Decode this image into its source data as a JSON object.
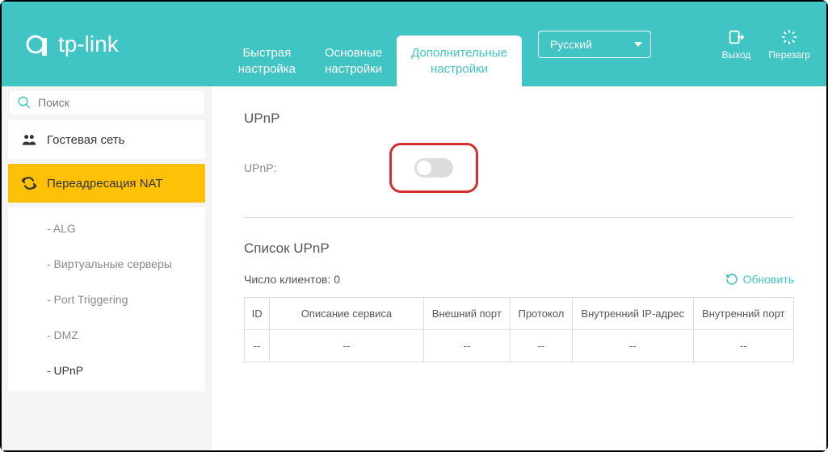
{
  "brand": "tp-link",
  "tabs": {
    "quick": "Быстрая\nнастройка",
    "basic": "Основные\nнастройки",
    "advanced": "Дополнительные\nнастройки"
  },
  "language": "Русский",
  "header_actions": {
    "logout": "Выход",
    "reboot": "Перезагр"
  },
  "search": {
    "placeholder": "Поиск"
  },
  "sidebar": {
    "guest_network": "Гостевая сеть",
    "nat_forwarding": "Переадресация NAT",
    "submenu": {
      "alg": "- ALG",
      "virtual_servers": "- Виртуальные серверы",
      "port_triggering": "- Port Triggering",
      "dmz": "- DMZ",
      "upnp": "- UPnP"
    }
  },
  "content": {
    "upnp_title": "UPnP",
    "upnp_label": "UPnP:",
    "list_title": "Список UPnP",
    "clients_label": "Число клиентов:",
    "clients_count": "0",
    "refresh": "Обновить",
    "table": {
      "headers": {
        "id": "ID",
        "desc": "Описание сервиса",
        "ext_port": "Внешний порт",
        "protocol": "Протокол",
        "int_ip": "Внутренний IP-адрес",
        "int_port": "Внутренний порт"
      },
      "empty": "--"
    }
  }
}
